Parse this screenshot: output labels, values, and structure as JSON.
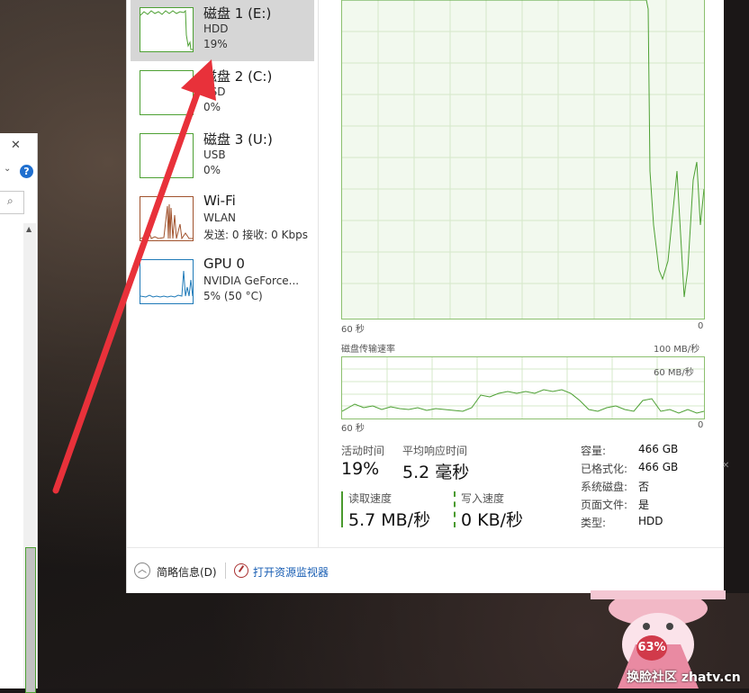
{
  "devices": [
    {
      "name": "磁盘 1 (E:)",
      "type": "HDD",
      "usage": "19%",
      "selected": true
    },
    {
      "name": "磁盘 2 (C:)",
      "type": "SSD",
      "usage": "0%",
      "selected": false
    },
    {
      "name": "磁盘 3 (U:)",
      "type": "USB",
      "usage": "0%",
      "selected": false
    },
    {
      "name": "Wi-Fi",
      "type": "WLAN",
      "usage": "发送: 0 接收: 0 Kbps",
      "selected": false
    },
    {
      "name": "GPU 0",
      "type": "NVIDIA GeForce...",
      "usage": "5% (50 °C)",
      "selected": false
    }
  ],
  "graph": {
    "active_time_x_left": "60 秒",
    "active_time_x_right": "0",
    "transfer_title": "磁盘传输速率",
    "transfer_max": "100 MB/秒",
    "transfer_mid": "60 MB/秒",
    "transfer_x_left": "60 秒",
    "transfer_x_right": "0"
  },
  "stats": {
    "active_time_label": "活动时间",
    "active_time_value": "19%",
    "avg_response_label": "平均响应时间",
    "avg_response_value": "5.2 毫秒",
    "read_label": "读取速度",
    "read_value": "5.7 MB/秒",
    "write_label": "写入速度",
    "write_value": "0 KB/秒"
  },
  "properties": [
    {
      "key": "容量:",
      "value": "466 GB"
    },
    {
      "key": "已格式化:",
      "value": "466 GB"
    },
    {
      "key": "系统磁盘:",
      "value": "否"
    },
    {
      "key": "页面文件:",
      "value": "是"
    },
    {
      "key": "类型:",
      "value": "HDD"
    }
  ],
  "footer": {
    "brief_label": "简略信息(D)",
    "monitor_link": "打开资源监视器"
  },
  "overlay": {
    "badge": "63%",
    "watermark": "换脸社区 zhatv.cn"
  },
  "colors": {
    "disk_line": "#4da033",
    "disk_fill": "#f2f9ee",
    "wifi_line": "#a0522d",
    "gpu_line": "#1f7ab8",
    "selected_bg": "#d6d6d6",
    "link": "#1a5fb4",
    "arrow": "#e8313a"
  },
  "icons": {
    "behind_close": "close-icon",
    "behind_help": "help-icon",
    "behind_search": "search-icon",
    "collapse": "chevron-up-icon",
    "monitor": "resource-monitor-icon"
  }
}
